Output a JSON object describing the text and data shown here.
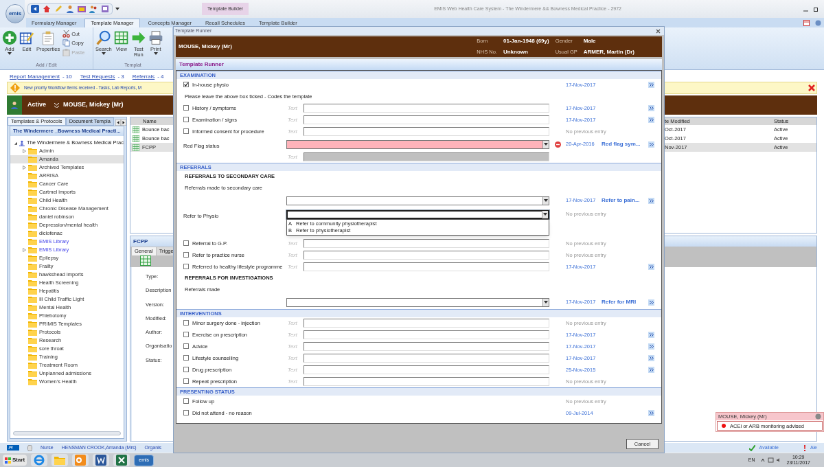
{
  "app": {
    "logo_text": "emis",
    "title": "EMIS Web Health Care System - The Windermere && Bowness Medical Practice - 2972",
    "context_tab": "Template Builder"
  },
  "tabs": [
    {
      "label": "Formulary Manager",
      "selected": false
    },
    {
      "label": "Template Manager",
      "selected": true
    },
    {
      "label": "Concepts Manager",
      "selected": false
    },
    {
      "label": "Recall Schedules",
      "selected": false
    },
    {
      "label": "Template Builder",
      "selected": false
    }
  ],
  "ribbon": [
    {
      "label": "Add / Edit",
      "buttons": [
        {
          "kind": "large",
          "label": "Add",
          "dropdown": true,
          "disabled": false
        },
        {
          "kind": "large",
          "label": "Edit",
          "dropdown": false,
          "disabled": false
        },
        {
          "kind": "large",
          "label": "Properties",
          "dropdown": false,
          "disabled": false
        },
        {
          "kind": "small",
          "label": "Cut",
          "disabled": false
        },
        {
          "kind": "small",
          "label": "Copy",
          "disabled": false
        },
        {
          "kind": "small",
          "label": "Paste",
          "disabled": true
        }
      ]
    },
    {
      "label": "Templat",
      "buttons": [
        {
          "kind": "large",
          "label": "Search",
          "dropdown": true,
          "disabled": false
        },
        {
          "kind": "large",
          "label": "View",
          "dropdown": false,
          "disabled": false
        },
        {
          "kind": "large",
          "label": "Test Run",
          "dropdown": false,
          "disabled": false
        },
        {
          "kind": "large",
          "label": "Print",
          "dropdown": true,
          "disabled": false
        }
      ]
    }
  ],
  "workflow_links": [
    {
      "label": "Report Management",
      "count": "- 10"
    },
    {
      "label": "Test Requests",
      "count": "- 3"
    },
    {
      "label": "Referrals",
      "count": "- 4"
    }
  ],
  "notification": "New priority Workflow Items received - Tasks, Lab Reports, M",
  "patient_bar": {
    "status": "Active",
    "patient": "MOUSE, Mickey (Mr)"
  },
  "left_panel": {
    "tabs": [
      {
        "label": "Templates & Protocols",
        "selected": true
      },
      {
        "label": "Document Templa",
        "selected": false
      }
    ],
    "header": "The Windermere _Bowness Medical Practi...",
    "tree": [
      {
        "label": "The Windermere & Bowness Medical Prac",
        "expanded": true,
        "children": [
          {
            "label": "Admin",
            "expandable": true,
            "selected": false,
            "library": false
          },
          {
            "label": "Amanda",
            "expandable": false,
            "selected": true,
            "library": false
          },
          {
            "label": "Archived Templates",
            "expandable": true,
            "selected": false,
            "library": false
          },
          {
            "label": "ARRISA",
            "expandable": false,
            "selected": false,
            "library": false
          },
          {
            "label": "Cancer Care",
            "expandable": false,
            "selected": false,
            "library": false
          },
          {
            "label": "Cartmel imports",
            "expandable": false,
            "selected": false,
            "library": false
          },
          {
            "label": "Child Health",
            "expandable": false,
            "selected": false,
            "library": false
          },
          {
            "label": "Chronic Disease Management",
            "expandable": false,
            "selected": false,
            "library": false
          },
          {
            "label": "daniel robinson",
            "expandable": false,
            "selected": false,
            "library": false
          },
          {
            "label": "Depression/mental health",
            "expandable": false,
            "selected": false,
            "library": false
          },
          {
            "label": "diclofenac",
            "expandable": false,
            "selected": false,
            "library": false
          },
          {
            "label": "EMIS Library",
            "expandable": false,
            "selected": false,
            "library": true
          },
          {
            "label": "EMIS Library",
            "expandable": true,
            "selected": false,
            "library": true
          },
          {
            "label": "Epilepsy",
            "expandable": false,
            "selected": false,
            "library": false
          },
          {
            "label": "Frailty",
            "expandable": false,
            "selected": false,
            "library": false
          },
          {
            "label": "hawkshead imports",
            "expandable": false,
            "selected": false,
            "library": false
          },
          {
            "label": "Health Screening",
            "expandable": false,
            "selected": false,
            "library": false
          },
          {
            "label": "Hepatitis",
            "expandable": false,
            "selected": false,
            "library": false
          },
          {
            "label": "Ill Child Traffic Light",
            "expandable": false,
            "selected": false,
            "library": false
          },
          {
            "label": "Mental Health",
            "expandable": false,
            "selected": false,
            "library": false
          },
          {
            "label": "Phlebotomy",
            "expandable": false,
            "selected": false,
            "library": false
          },
          {
            "label": "PRIMIS Templates",
            "expandable": false,
            "selected": false,
            "library": false
          },
          {
            "label": "Protocols",
            "expandable": false,
            "selected": false,
            "library": false
          },
          {
            "label": "Research",
            "expandable": false,
            "selected": false,
            "library": false
          },
          {
            "label": "sore throat",
            "expandable": false,
            "selected": false,
            "library": false
          },
          {
            "label": "Training",
            "expandable": false,
            "selected": false,
            "library": false
          },
          {
            "label": "Treatment Room",
            "expandable": false,
            "selected": false,
            "library": false
          },
          {
            "label": "Unplanned admissions",
            "expandable": false,
            "selected": false,
            "library": false
          },
          {
            "label": "Women's Health",
            "expandable": false,
            "selected": false,
            "library": false
          }
        ]
      }
    ]
  },
  "templates_table": {
    "columns": [
      "Name",
      "te Modified",
      "Status"
    ],
    "rows": [
      {
        "cells": [
          "Bounce bac",
          "Oct-2017",
          "Active"
        ],
        "selected": false
      },
      {
        "cells": [
          "Bounce bac",
          "Oct-2017",
          "Active"
        ],
        "selected": false
      },
      {
        "cells": [
          "FCPP",
          "Nov-2017",
          "Active"
        ],
        "selected": true
      }
    ]
  },
  "details": {
    "title": "FCPP",
    "tabs": [
      {
        "label": "General",
        "selected": true
      },
      {
        "label": "Trigge",
        "selected": false
      }
    ],
    "fields": [
      "Type:",
      "Description",
      "Version:",
      "Modified:",
      "Author:",
      "Organisatio",
      "Status:"
    ]
  },
  "status_bar": {
    "role": "Nurse",
    "user": "HENSMAN CROOK,Amanda (Mrs)",
    "organisation": "Organis",
    "availability": "Available",
    "alerts": "Ale"
  },
  "alert_popup": {
    "title": "MOUSE, Mickey (Mr)",
    "message": "ACEi or ARB monitoring advised",
    "color": "#ee1111"
  },
  "taskbar": {
    "start": "Start",
    "emis_label": "emis",
    "language": "EN",
    "time": "10:29",
    "date": "23/11/2017"
  },
  "dialog": {
    "window_title": "Template Runner",
    "patient": "MOUSE, Mickey (Mr)",
    "details": [
      {
        "label": "Born",
        "value": "01-Jan-1948 (69y)"
      },
      {
        "label": "Gender",
        "value": "Male"
      },
      {
        "label": "NHS No.",
        "value": "Unknown"
      },
      {
        "label": "Usual GP",
        "value": "ARMER, Martin (Dr)"
      }
    ],
    "heading": "Template Runner",
    "sections": [
      {
        "title": "EXAMINATION",
        "items": [
          {
            "kind": "check",
            "label": "In-house physio",
            "checked": true,
            "previous": "17-Nov-2017",
            "recorded": true
          },
          {
            "kind": "note",
            "text": "Please leave the above box ticked - Codes the template"
          },
          {
            "kind": "check",
            "label": "History / symptoms",
            "checked": false,
            "text_label": "Text",
            "previous": "17-Nov-2017",
            "recorded": true
          },
          {
            "kind": "check",
            "label": "Examination / signs",
            "checked": false,
            "text_label": "Text",
            "previous": "17-Nov-2017",
            "recorded": true
          },
          {
            "kind": "check",
            "label": "Informed consent for procedure",
            "checked": false,
            "text_label": "Text",
            "previous": "No previous entry",
            "recorded": false
          },
          {
            "kind": "select",
            "label": "Red Flag status",
            "alert": true,
            "expanded": false,
            "previous": "20-Apr-2016",
            "recorded": true,
            "link": "Red flag sym..."
          },
          {
            "kind": "text",
            "text_label": "Text",
            "disabled": true
          }
        ]
      },
      {
        "title": "REFERRALS",
        "items": [
          {
            "kind": "heading",
            "text": "REFERRALS TO SECONDARY CARE"
          },
          {
            "kind": "note",
            "text": "Referrals made to secondary care"
          },
          {
            "kind": "select",
            "alert": false,
            "expanded": false,
            "previous": "17-Nov-2017",
            "recorded": true,
            "link": "Refer to pain..."
          },
          {
            "kind": "select",
            "label": "Refer to Physio",
            "alert": false,
            "expanded": true,
            "options": [
              {
                "key": "A",
                "text": "Refer to community physiotherapist"
              },
              {
                "key": "B",
                "text": "Refer to physiotherapist"
              }
            ],
            "previous": "No previous entry",
            "recorded": false
          },
          {
            "kind": "check",
            "label": "Referral to G.P.",
            "checked": false,
            "text_label": "Text",
            "previous": "No previous entry",
            "recorded": false
          },
          {
            "kind": "check",
            "label": "Refer to practice nurse",
            "checked": false,
            "text_label": "Text",
            "previous": "No previous entry",
            "recorded": false
          },
          {
            "kind": "check",
            "label": "Referred to healthy lifestyle programme",
            "checked": false,
            "text_label": "Text",
            "previous": "17-Nov-2017",
            "recorded": true
          },
          {
            "kind": "heading",
            "text": "REFERRALS FOR INVESTIGATIONS"
          },
          {
            "kind": "note",
            "text": "Referrals made"
          },
          {
            "kind": "select",
            "alert": false,
            "expanded": false,
            "previous": "17-Nov-2017",
            "recorded": true,
            "link": "Refer for MRI"
          }
        ]
      },
      {
        "title": "INTERVENTIONS",
        "items": [
          {
            "kind": "check",
            "label": "Minor surgery done - injection",
            "checked": false,
            "text_label": "Text",
            "previous": "No previous entry",
            "recorded": false
          },
          {
            "kind": "check",
            "label": "Exercise on prescription",
            "checked": false,
            "text_label": "Text",
            "previous": "17-Nov-2017",
            "recorded": true
          },
          {
            "kind": "check",
            "label": "Advice",
            "checked": false,
            "text_label": "Text",
            "previous": "17-Nov-2017",
            "recorded": true
          },
          {
            "kind": "check",
            "label": "Lifestyle counselling",
            "checked": false,
            "text_label": "Text",
            "previous": "17-Nov-2017",
            "recorded": true
          },
          {
            "kind": "check",
            "label": "Drug prescription",
            "checked": false,
            "text_label": "Text",
            "previous": "25-Nov-2015",
            "recorded": true
          },
          {
            "kind": "check",
            "label": "Repeat prescription",
            "checked": false,
            "text_label": "Text",
            "previous": "No previous entry",
            "recorded": false
          }
        ]
      },
      {
        "title": "PRESENTING STATUS",
        "items": [
          {
            "kind": "check",
            "label": "Follow up",
            "checked": false,
            "previous": "No previous entry",
            "recorded": false
          },
          {
            "kind": "check",
            "label": "Did not attend - no reason",
            "checked": false,
            "previous": "09-Jul-2014",
            "recorded": true
          }
        ]
      }
    ],
    "cancel": "Cancel"
  }
}
